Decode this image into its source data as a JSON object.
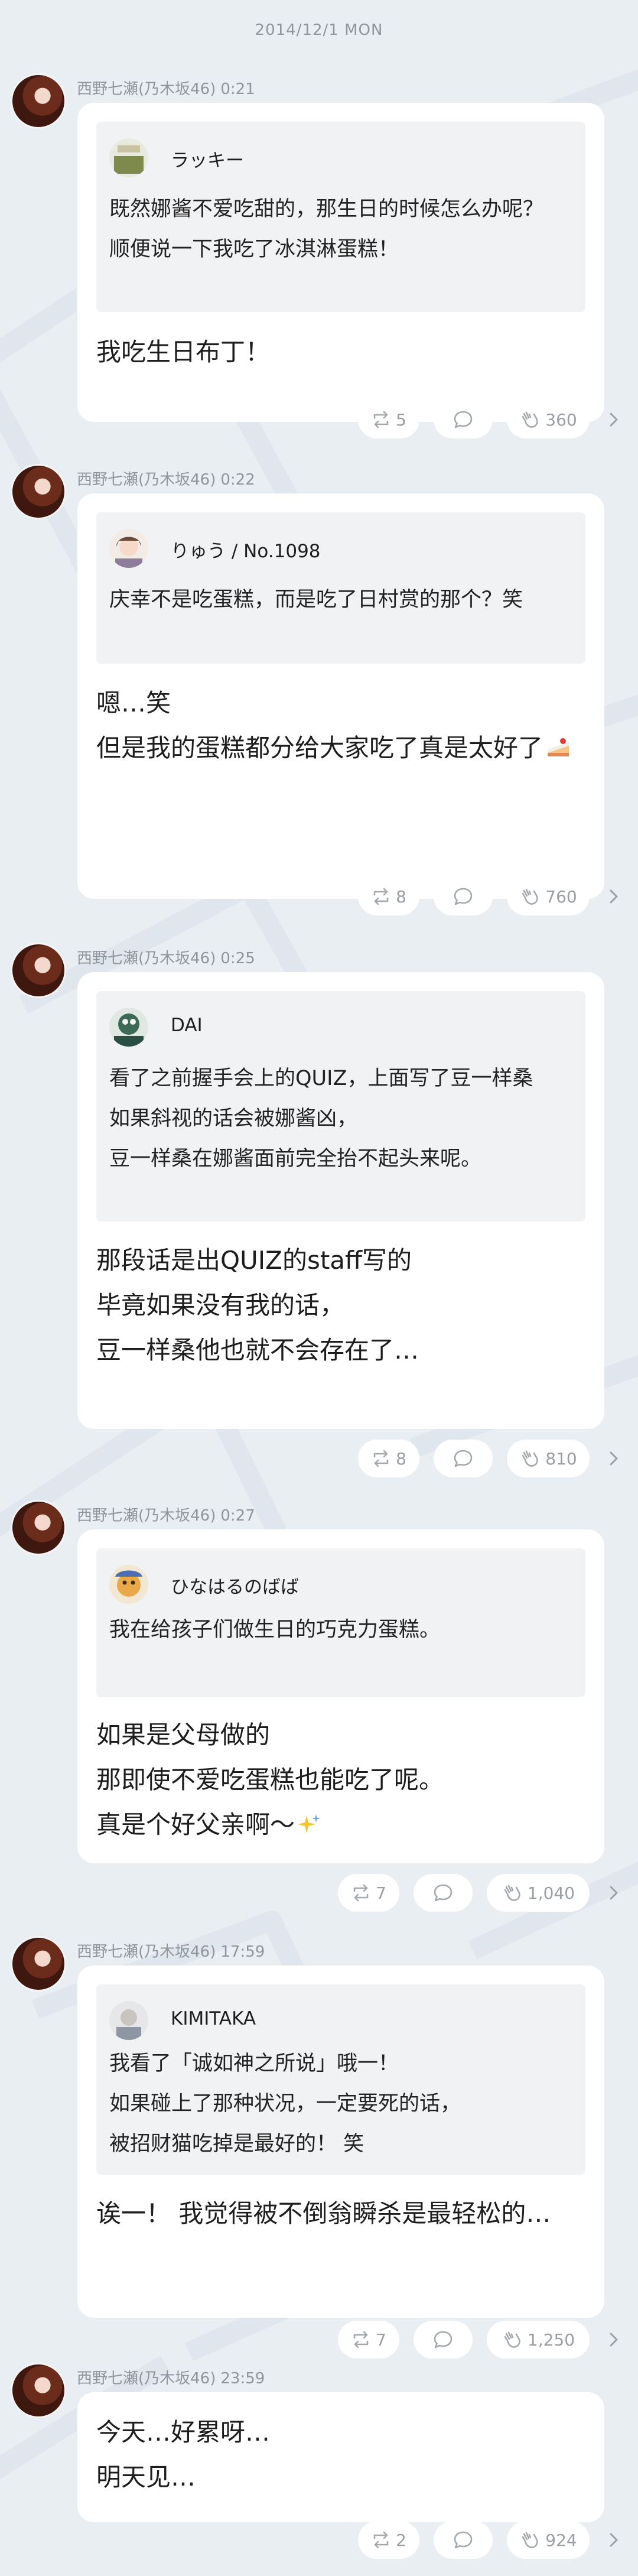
{
  "date_header": "2014/12/1 MON",
  "author": "西野七瀬(乃木坂46)",
  "icons": {
    "retweet": "retweet-icon",
    "comment": "comment-icon",
    "like": "clap-icon",
    "more": "chevron-right-icon",
    "cake": "cake-emoji",
    "sparkle": "sparkle-emoji"
  },
  "colors": {
    "background": "#e9eef3",
    "bubble": "#ffffff",
    "quote_bg": "#f1f2f3",
    "meta_text": "#8f959c"
  },
  "posts": [
    {
      "time": "0:21",
      "quote": {
        "name": "ラッキー",
        "lines": [
          "既然娜酱不爱吃甜的，那生日的时候怎么办呢？",
          "顺便说一下我吃了冰淇淋蛋糕！"
        ]
      },
      "message": [
        "我吃生日布丁！"
      ],
      "reposts": "5",
      "likes": "360"
    },
    {
      "time": "0:22",
      "quote": {
        "name": "りゅう / No.1098",
        "lines": [
          "庆幸不是吃蛋糕，而是吃了日村赏的那个？笑"
        ]
      },
      "message": [
        "嗯…笑",
        "但是我的蛋糕都分给大家吃了真是太好了"
      ],
      "reposts": "8",
      "likes": "760"
    },
    {
      "time": "0:25",
      "quote": {
        "name": "DAI",
        "lines": [
          "看了之前握手会上的QUIZ，上面写了豆一样桑",
          "如果斜视的话会被娜酱凶，",
          "豆一样桑在娜酱面前完全抬不起头来呢。"
        ]
      },
      "message": [
        "那段话是出QUIZ的staff写的",
        "毕竟如果没有我的话，",
        "豆一样桑他也就不会存在了…"
      ],
      "reposts": "8",
      "likes": "810"
    },
    {
      "time": "0:27",
      "quote": {
        "name": "ひなはるのばば",
        "lines": [
          "我在给孩子们做生日的巧克力蛋糕。"
        ]
      },
      "message": [
        "如果是父母做的",
        "那即使不爱吃蛋糕也能吃了呢。",
        "真是个好父亲啊〜"
      ],
      "reposts": "7",
      "likes": "1,040"
    },
    {
      "time": "17:59",
      "quote": {
        "name": "KIMITAKA",
        "lines": [
          "我看了「诚如神之所说」哦一！",
          "如果碰上了那种状况，一定要死的话，",
          "被招财猫吃掉是最好的！ 笑"
        ]
      },
      "message": [
        "诶一！ 我觉得被不倒翁瞬杀是最轻松的…"
      ],
      "reposts": "7",
      "likes": "1,250"
    },
    {
      "time": "23:59",
      "message": [
        "今天…好累呀…",
        "明天见…"
      ],
      "reposts": "2",
      "likes": "924"
    }
  ]
}
